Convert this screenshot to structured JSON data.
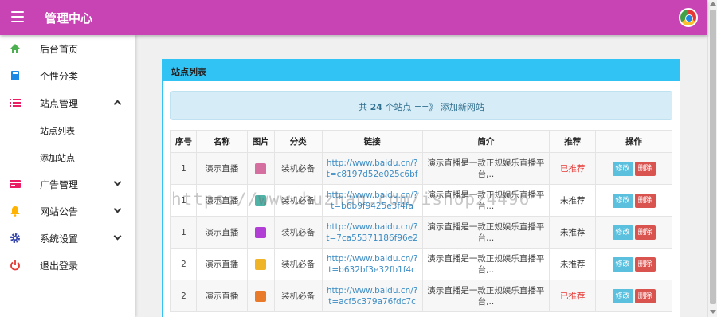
{
  "header": {
    "title": "管理中心"
  },
  "sidebar": {
    "items": [
      {
        "label": "后台首页",
        "icon": "home-icon",
        "color": "#4caf50"
      },
      {
        "label": "个性分类",
        "icon": "book-icon",
        "color": "#1e88e5"
      },
      {
        "label": "站点管理",
        "icon": "list-icon",
        "color": "#e91e63",
        "expanded": true,
        "children": [
          {
            "label": "站点列表"
          },
          {
            "label": "添加站点"
          }
        ]
      },
      {
        "label": "广告管理",
        "icon": "card-icon",
        "color": "#e91e63"
      },
      {
        "label": "网站公告",
        "icon": "bell-icon",
        "color": "#ffb300"
      },
      {
        "label": "系统设置",
        "icon": "gear-icon",
        "color": "#3949ab"
      },
      {
        "label": "退出登录",
        "icon": "power-icon",
        "color": "#e53935"
      }
    ]
  },
  "panel": {
    "title": "站点列表",
    "summary_prefix": "共",
    "summary_count": "24",
    "summary_suffix": "个站点 ==》",
    "summary_link": "添加新网站"
  },
  "table": {
    "headers": [
      "序号",
      "名称",
      "图片",
      "分类",
      "链接",
      "简介",
      "推荐",
      "操作"
    ],
    "edit_label": "修改",
    "delete_label": "删除",
    "rows": [
      {
        "seq": "1",
        "name": "演示直播",
        "thumb_color": "#d46fa0",
        "category": "装机必备",
        "url": "http://www.baidu.cn/?t=c8197d52e025c6bf",
        "intro": "演示直播是一款正规娱乐直播平台,..",
        "recommend": "已推荐",
        "recommended": true
      },
      {
        "seq": "1",
        "name": "演示直播",
        "thumb_color": "#4fb3a8",
        "category": "装机必备",
        "url": "http://www.baidu.cn/?t=b6b9f9425e3f4fa",
        "intro": "演示直播是一款正规娱乐直播平台,..",
        "recommend": "未推荐",
        "recommended": false
      },
      {
        "seq": "1",
        "name": "演示直播",
        "thumb_color": "#b13fd6",
        "category": "装机必备",
        "url": "http://www.baidu.cn/?t=7ca55371186f96e2",
        "intro": "演示直播是一款正规娱乐直播平台,..",
        "recommend": "未推荐",
        "recommended": false
      },
      {
        "seq": "2",
        "name": "演示直播",
        "thumb_color": "#f0b429",
        "category": "装机必备",
        "url": "http://www.baidu.cn/?t=b632bf3e32fb1f4c",
        "intro": "演示直播是一款正规娱乐直播平台,..",
        "recommend": "未推荐",
        "recommended": false
      },
      {
        "seq": "2",
        "name": "演示直播",
        "thumb_color": "#e87a2a",
        "category": "装机必备",
        "url": "http://www.baidu.cn/?t=acf5c379a76fdc7c",
        "intro": "演示直播是一款正规娱乐直播平台,..",
        "recommend": "已推荐",
        "recommended": true
      }
    ]
  },
  "watermark": "https://www.huzhan.com/ishop24496"
}
